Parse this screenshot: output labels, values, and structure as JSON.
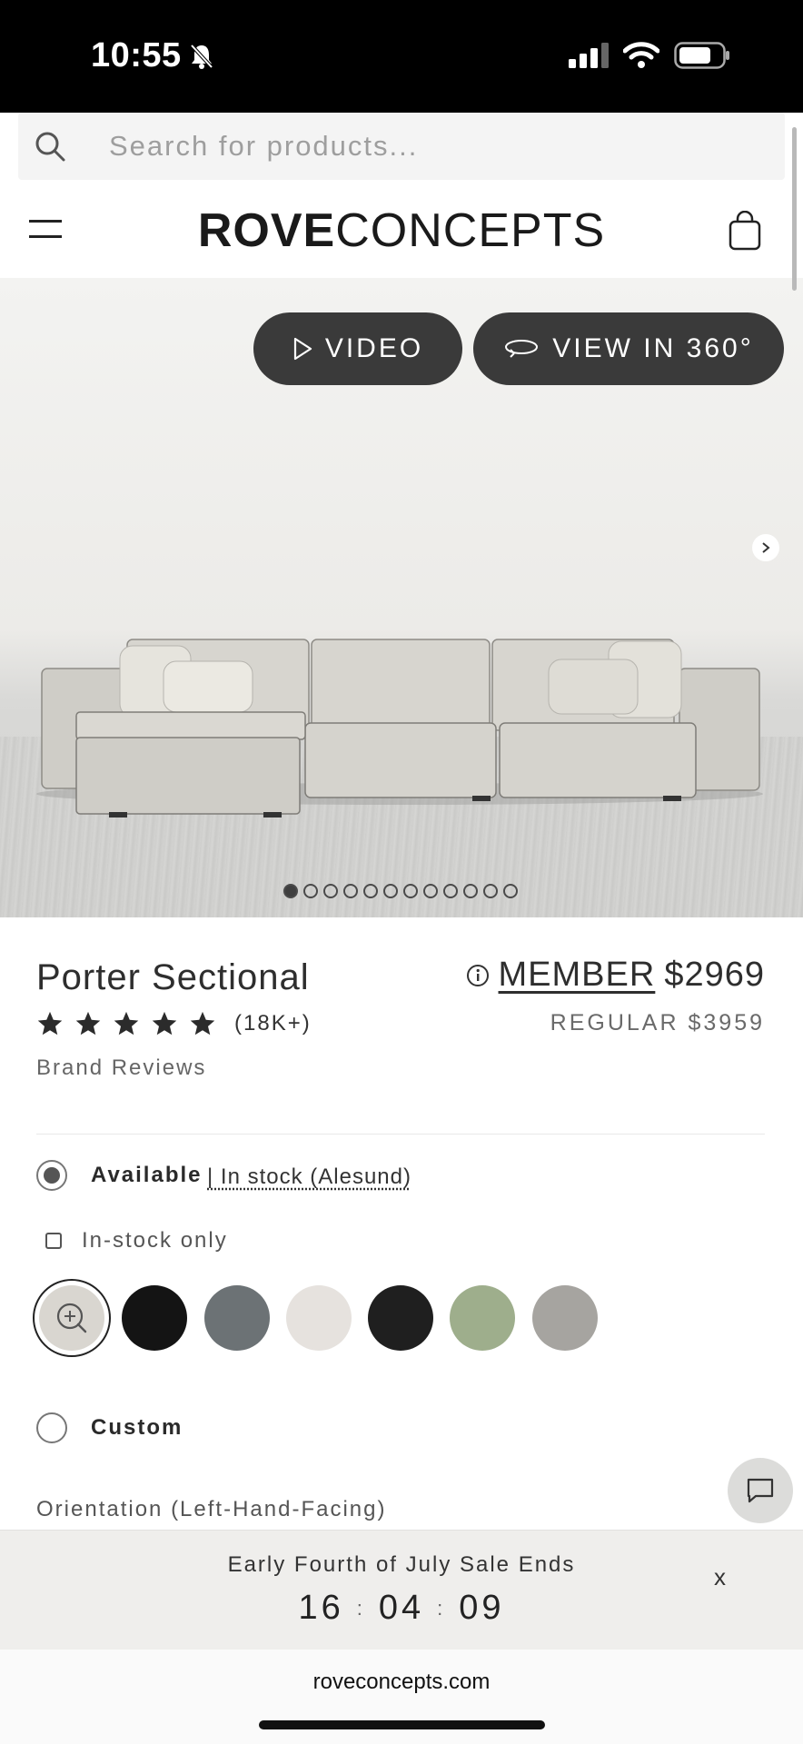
{
  "status_bar": {
    "time": "10:55"
  },
  "search": {
    "placeholder": "Search for products..."
  },
  "header": {
    "logo_bold": "ROVE",
    "logo_light": "CONCEPTS"
  },
  "hero": {
    "video_label": "VIDEO",
    "view360_label": "VIEW IN 360°",
    "slide_count": 12,
    "active_slide": 1
  },
  "product": {
    "name": "Porter Sectional",
    "rating_stars": 5,
    "review_count": "(18K+)",
    "brand_reviews": "Brand Reviews",
    "member_label": "MEMBER",
    "member_price": "$2969",
    "regular_price": "REGULAR $3959"
  },
  "options": {
    "available_label": "Available",
    "stock_location": "| In stock (Alesund)",
    "instock_only_label": "In-stock only",
    "custom_label": "Custom",
    "orientation_label": "Orientation (Left-Hand-Facing)",
    "swatches": [
      {
        "name": "light-grey",
        "color": "#d9d6d0"
      },
      {
        "name": "black",
        "color": "#141414"
      },
      {
        "name": "slate-grey",
        "color": "#6c7275"
      },
      {
        "name": "white-boucle",
        "color": "#e6e2de"
      },
      {
        "name": "charcoal-black",
        "color": "#1f1f1f"
      },
      {
        "name": "sage-green",
        "color": "#9eae8c"
      },
      {
        "name": "warm-grey",
        "color": "#a6a4a0"
      }
    ]
  },
  "sale_banner": {
    "title": "Early Fourth of July Sale Ends",
    "hours": "16",
    "minutes": "04",
    "seconds": "09",
    "close_label": "x"
  },
  "browser": {
    "url": "roveconcepts.com"
  }
}
